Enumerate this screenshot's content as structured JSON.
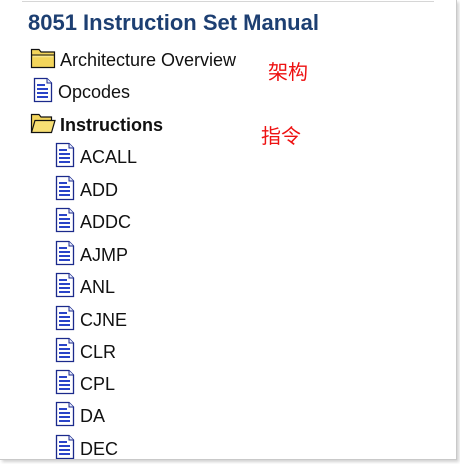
{
  "manual": {
    "title": "8051 Instruction Set Manual"
  },
  "tree": {
    "architecture": {
      "label": "Architecture Overview",
      "icon": "folder-closed-icon"
    },
    "opcodes": {
      "label": "Opcodes",
      "icon": "page-icon"
    },
    "instructions": {
      "label": "Instructions",
      "icon": "folder-open-icon",
      "children": [
        "ACALL",
        "ADD",
        "ADDC",
        "AJMP",
        "ANL",
        "CJNE",
        "CLR",
        "CPL",
        "DA",
        "DEC"
      ]
    }
  },
  "annotations": {
    "architecture_note": "架构",
    "instructions_note": "指令"
  },
  "colors": {
    "title": "#1d3f72",
    "annotation": "#ee1111",
    "folder_fill": "#f3d55b",
    "page_lines": "#2a44c8"
  }
}
